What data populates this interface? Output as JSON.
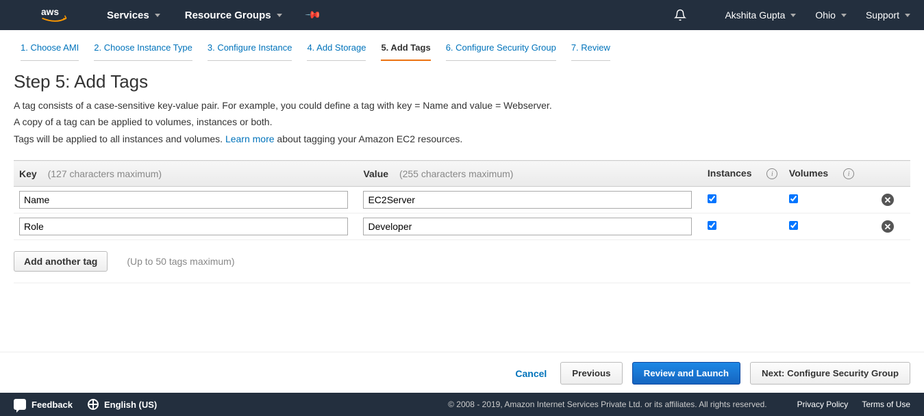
{
  "nav": {
    "services": "Services",
    "resource_groups": "Resource Groups",
    "user": "Akshita Gupta",
    "region": "Ohio",
    "support": "Support"
  },
  "wizard": {
    "steps": [
      "1. Choose AMI",
      "2. Choose Instance Type",
      "3. Configure Instance",
      "4. Add Storage",
      "5. Add Tags",
      "6. Configure Security Group",
      "7. Review"
    ],
    "active_index": 4
  },
  "page": {
    "title": "Step 5: Add Tags",
    "desc1": "A tag consists of a case-sensitive key-value pair. For example, you could define a tag with key = Name and value = Webserver.",
    "desc2": "A copy of a tag can be applied to volumes, instances or both.",
    "desc3_prefix": "Tags will be applied to all instances and volumes. ",
    "desc3_link": "Learn more",
    "desc3_suffix": " about tagging your Amazon EC2 resources."
  },
  "table": {
    "key_hdr": "Key",
    "key_sub": "(127 characters maximum)",
    "value_hdr": "Value",
    "value_sub": "(255 characters maximum)",
    "instances_hdr": "Instances",
    "volumes_hdr": "Volumes",
    "rows": [
      {
        "key": "Name",
        "value": "EC2Server",
        "instances": true,
        "volumes": true
      },
      {
        "key": "Role",
        "value": "Developer",
        "instances": true,
        "volumes": true
      }
    ]
  },
  "add_tag": {
    "label": "Add another tag",
    "hint": "(Up to 50 tags maximum)"
  },
  "actions": {
    "cancel": "Cancel",
    "previous": "Previous",
    "review": "Review and Launch",
    "next": "Next: Configure Security Group"
  },
  "footer": {
    "feedback": "Feedback",
    "language": "English (US)",
    "copyright": "© 2008 - 2019, Amazon Internet Services Private Ltd. or its affiliates. All rights reserved.",
    "privacy": "Privacy Policy",
    "terms": "Terms of Use"
  }
}
